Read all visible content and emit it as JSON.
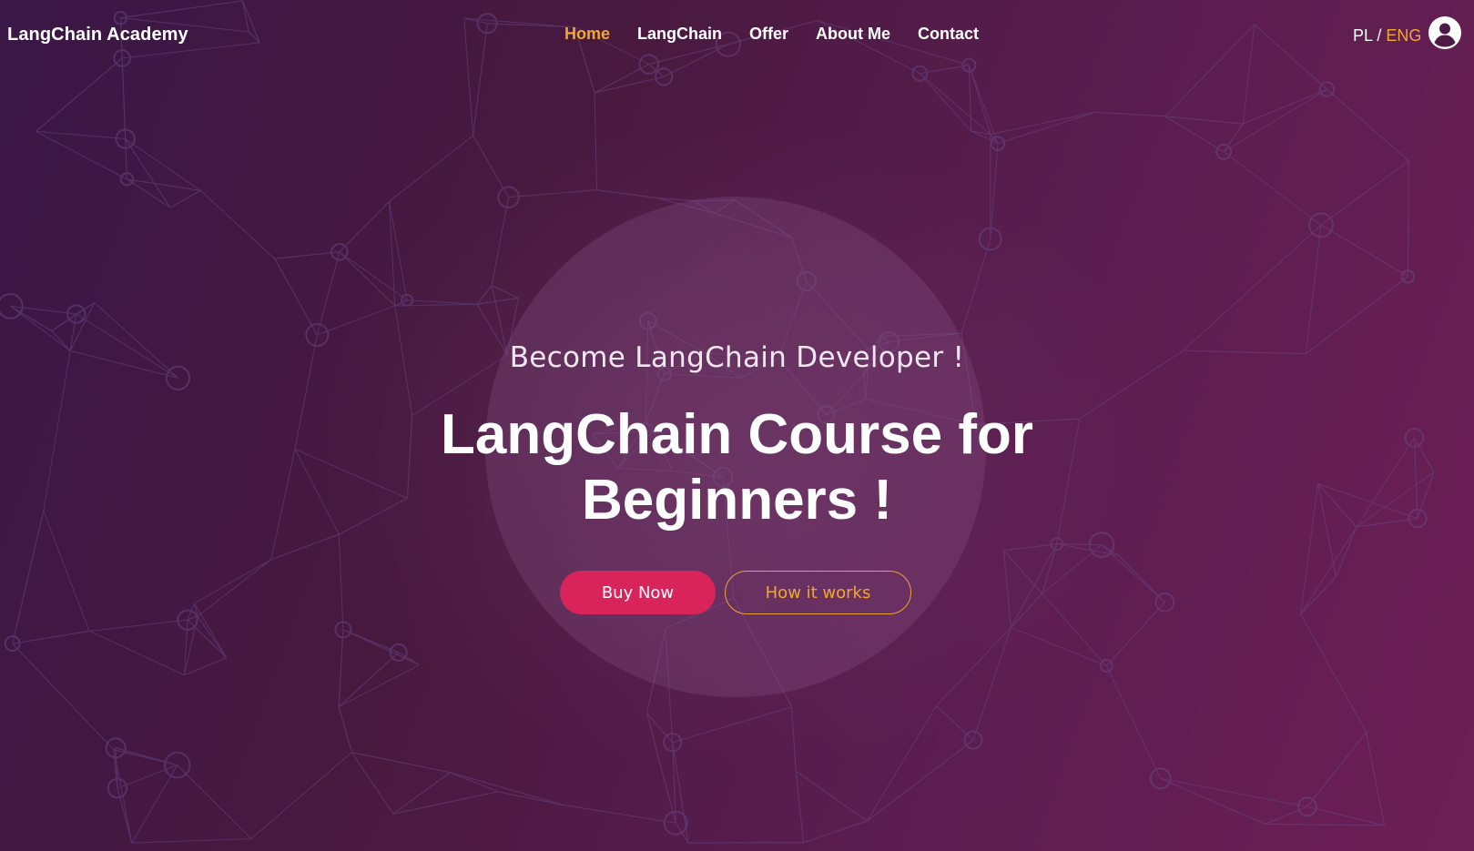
{
  "header": {
    "brand": "LangChain Academy",
    "nav": [
      {
        "label": "Home",
        "active": true
      },
      {
        "label": "LangChain",
        "active": false
      },
      {
        "label": "Offer",
        "active": false
      },
      {
        "label": "About Me",
        "active": false
      },
      {
        "label": "Contact",
        "active": false
      }
    ],
    "lang": {
      "pl": "PL",
      "sep": " / ",
      "eng": "ENG",
      "active": "ENG"
    },
    "user_icon": "user-circle-icon"
  },
  "hero": {
    "subtitle": "Become LangChain Developer !",
    "title_line1": "LangChain Course for",
    "title_line2": "Beginners !",
    "buy_label": "Buy Now",
    "how_label": "How it works"
  },
  "colors": {
    "accent": "#f0a830",
    "primary_button": "#d8245a",
    "background_start": "#3a1746",
    "background_end": "#6c1f55"
  }
}
